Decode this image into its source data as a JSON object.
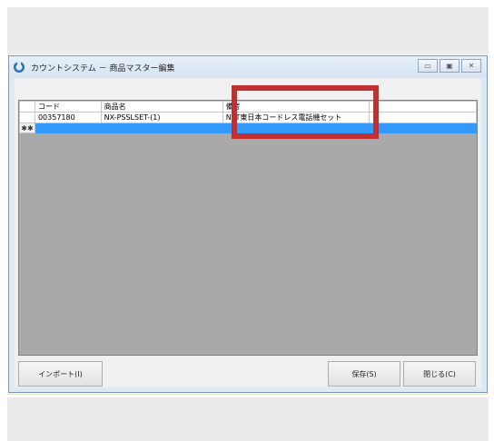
{
  "window": {
    "title": "カウントシステム － 商品マスター編集",
    "buttons": {
      "minimize": "▭",
      "maximize": "▣",
      "close": "✕"
    }
  },
  "grid": {
    "columns": [
      "コード",
      "商品名",
      "備考"
    ],
    "rows": [
      {
        "code": "00357180",
        "name": "NX-PSSLSET-(1)",
        "note": "NTT東日本コードレス電話機セット"
      }
    ],
    "new_row_marker": "✱✱",
    "selection_color": "#3399ff",
    "background_color": "#a9a9a9"
  },
  "highlight": {
    "target": "備考",
    "color": "#c03030"
  },
  "footer": {
    "import_label": "インポート(I)",
    "save_label": "保存(S)",
    "close_label": "閉じる(C)"
  }
}
